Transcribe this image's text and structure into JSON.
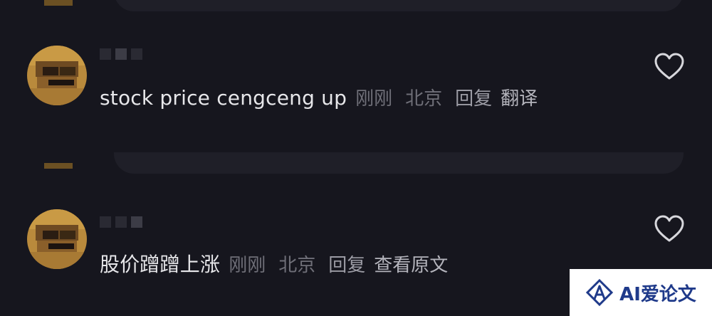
{
  "comments": [
    {
      "text": "stock price cengceng up",
      "time": "刚刚",
      "location": "北京",
      "reply_label": "回复",
      "action_label": "翻译"
    },
    {
      "text": "股价蹭蹭上涨",
      "time": "刚刚",
      "location": "北京",
      "reply_label": "回复",
      "action_label": "查看原文"
    }
  ],
  "icons": {
    "like": "heart-outline-icon"
  },
  "watermark": {
    "text": "AI爱论文"
  },
  "colors": {
    "background": "#16161e",
    "card": "#1f1f28",
    "comment_text": "#e7e7ea",
    "meta_text": "#6f6f78",
    "action_text": "#9b9ba4",
    "watermark_blue": "#1f3a8a"
  }
}
